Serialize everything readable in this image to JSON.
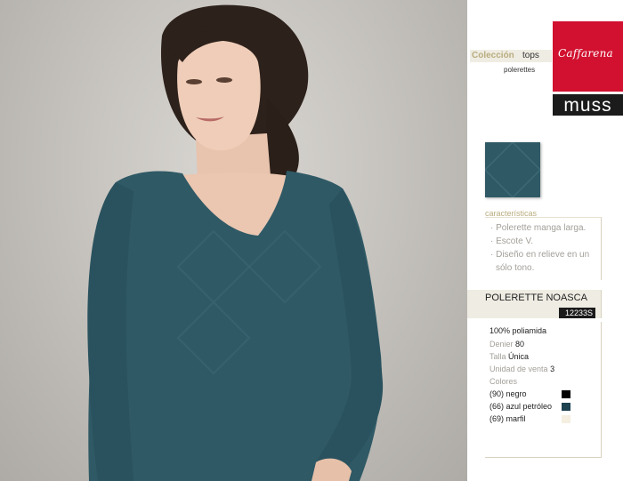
{
  "header": {
    "collection_label": "Colección",
    "collection_value": "tops",
    "subcategory": "polerettes"
  },
  "brands": {
    "primary": "Caffarena",
    "secondary": "MUSS"
  },
  "swatch": {
    "color": "#2f5965"
  },
  "characteristics": {
    "label": "características",
    "items": [
      "· Polerette manga larga.",
      "· Escote V.",
      "· Diseño en relieve en un",
      "  sólo tono."
    ]
  },
  "product": {
    "name": "POLERETTE NOASCA",
    "code": "12233S"
  },
  "specs": {
    "material": "100% poliamida",
    "denier_label": "Denier",
    "denier_value": "80",
    "talla_label": "Talla",
    "talla_value": "Única",
    "unidad_label": "Unidad de venta",
    "unidad_value": "3",
    "colores_label": "Colores"
  },
  "colors": [
    {
      "label": "(90) negro",
      "hex": "#000000"
    },
    {
      "label": "(66) azul petróleo",
      "hex": "#1d4250"
    },
    {
      "label": "(69) marfil",
      "hex": "#f5efe1"
    }
  ]
}
